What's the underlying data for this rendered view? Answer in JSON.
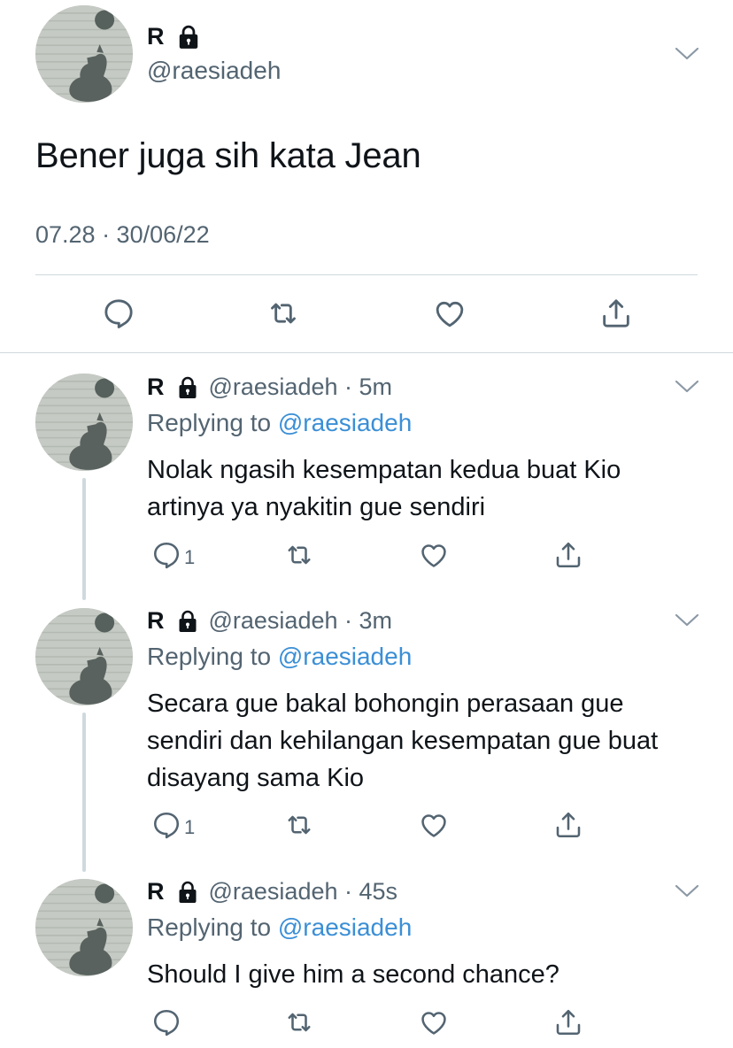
{
  "main_tweet": {
    "name": "R",
    "handle": "@raesiadeh",
    "text": "Bener juga sih kata Jean",
    "timestamp": "07.28 · 30/06/22",
    "icons": [
      "lock-icon",
      "chevron-down-icon",
      "reply-icon",
      "retweet-icon",
      "like-icon",
      "share-icon"
    ]
  },
  "replies": [
    {
      "name": "R",
      "handle_time": "@raesiadeh · 5m",
      "replying_prefix": "Replying to",
      "replying_to": "@raesiadeh",
      "text": "Nolak ngasih kesempatan kedua buat Kio artinya ya nyakitin gue sendiri",
      "reply_count": "1"
    },
    {
      "name": "R",
      "handle_time": "@raesiadeh · 3m",
      "replying_prefix": "Replying to",
      "replying_to": "@raesiadeh",
      "text": "Secara gue bakal bohongin perasaan gue sendiri dan kehilangan kesempatan gue buat disayang sama Kio",
      "reply_count": "1"
    },
    {
      "name": "R",
      "handle_time": "@raesiadeh · 45s",
      "replying_prefix": "Replying to",
      "replying_to": "@raesiadeh",
      "text": "Should I give him a second chance?",
      "reply_count": ""
    }
  ],
  "colors": {
    "text": "#0f1419",
    "secondary": "#536471",
    "link": "#3b8fd6",
    "divider": "#cfd9de"
  }
}
